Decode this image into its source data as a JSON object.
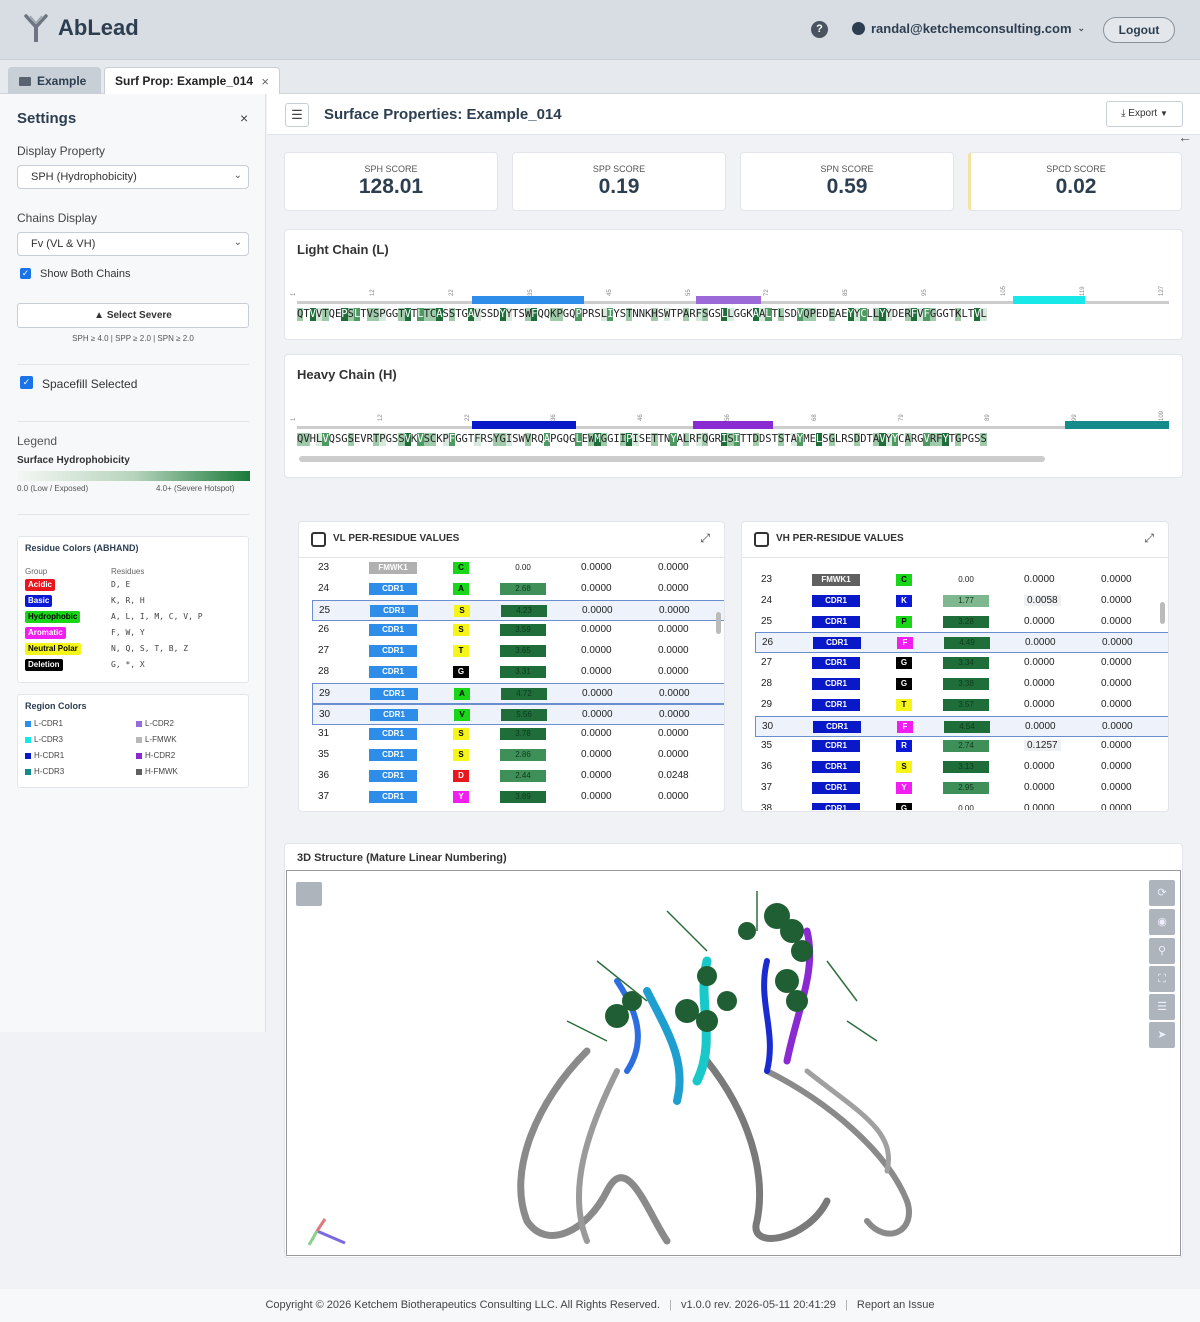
{
  "app": {
    "name": "AbLead",
    "user_email": "randal@ketchemconsulting.com",
    "logout_label": "Logout"
  },
  "tabs": [
    {
      "label": "Example"
    },
    {
      "label": "Surf Prop: Example_014"
    }
  ],
  "sidebar": {
    "title": "Settings",
    "display_property_label": "Display Property",
    "display_property_value": "SPH (Hydrophobicity)",
    "chains_display_label": "Chains Display",
    "chains_display_value": "Fv (VL & VH)",
    "show_both_chains_label": "Show Both Chains",
    "select_severe_label": "Select Severe",
    "severe_note": "SPH ≥ 4.0 | SPP ≥ 2.0 | SPN ≥ 2.0",
    "spacefill_label": "Spacefill Selected",
    "legend_label": "Legend",
    "legend_title": "Surface Hydrophobicity",
    "legend_low": "0.0 (Low / Exposed)",
    "legend_high": "4.0+ (Severe Hotspot)",
    "residue_colors": {
      "title": "Residue Colors (ABHAND)",
      "col_group": "Group",
      "col_residues": "Residues",
      "groups": [
        {
          "name": "Acidic",
          "residues": "D, E",
          "bg": "#e8171e",
          "fg": "#ffffff"
        },
        {
          "name": "Basic",
          "residues": "K, R, H",
          "bg": "#0a19d6",
          "fg": "#ffffff"
        },
        {
          "name": "Hydrophobic",
          "residues": "A, L, I, M, C, V, P",
          "bg": "#19d619",
          "fg": "#000000"
        },
        {
          "name": "Aromatic",
          "residues": "F, W, Y",
          "bg": "#f01ef0",
          "fg": "#ffffff"
        },
        {
          "name": "Neutral Polar",
          "residues": "N, Q, S, T, B, Z",
          "bg": "#f5f519",
          "fg": "#000000"
        },
        {
          "name": "Deletion",
          "residues": "G, *, X",
          "bg": "#000000",
          "fg": "#ffffff"
        }
      ]
    },
    "region_colors": {
      "title": "Region Colors",
      "items": [
        {
          "name": "L-CDR1",
          "color": "#2d8de8"
        },
        {
          "name": "L-CDR2",
          "color": "#9b6ad8"
        },
        {
          "name": "L-CDR3",
          "color": "#19e8e8"
        },
        {
          "name": "L-FMWK",
          "color": "#b8b8b8"
        },
        {
          "name": "H-CDR1",
          "color": "#0a19c8"
        },
        {
          "name": "H-CDR2",
          "color": "#8a2bd2"
        },
        {
          "name": "H-CDR3",
          "color": "#148a8a"
        },
        {
          "name": "H-FMWK",
          "color": "#606060"
        }
      ]
    }
  },
  "main": {
    "title": "Surface Properties: Example_014",
    "export_label": "Export",
    "scores": [
      {
        "label": "SPH SCORE",
        "value": "128.01"
      },
      {
        "label": "SPP SCORE",
        "value": "0.19"
      },
      {
        "label": "SPN SCORE",
        "value": "0.59"
      },
      {
        "label": "SPCD SCORE",
        "value": "0.02"
      }
    ],
    "light_chain": {
      "title": "Light Chain (L)",
      "numbers": [
        "1",
        "12",
        "22",
        "35",
        "45",
        "55",
        "72",
        "85",
        "95",
        "105",
        "119",
        "127"
      ],
      "sequence": "QTVVTQEPSLTVSPGGTVTLTCASSTGAVSSDYYTSWFQQKPGQPPRSLIYSTNNKHSWTPARFSGSLLGGKAALTLSDVQPEDEAEYYCLLYYDERFVFGGGTKLTVL",
      "regions": [
        {
          "start_pct": 20.1,
          "end_pct": 32.9,
          "color": "#2d8de8"
        },
        {
          "start_pct": 45.8,
          "end_pct": 53.2,
          "color": "#9b6ad8"
        },
        {
          "start_pct": 82.1,
          "end_pct": 90.4,
          "color": "#19e8e8"
        }
      ]
    },
    "heavy_chain": {
      "title": "Heavy Chain (H)",
      "numbers": [
        "1",
        "12",
        "22",
        "36",
        "46",
        "56",
        "68",
        "79",
        "89",
        "99",
        "109"
      ],
      "sequence": "QVHLVQSGSEVRTPGSSVKVSCKPFGGTFRSYGISWVRQAPGQGLEWMGGIIPISETTNYALRFQGRISITTDDSTSTAYMELSGLRSDDTAVYYCARGVRFYTGPGSS",
      "regions": [
        {
          "start_pct": 20.1,
          "end_pct": 32.0,
          "color": "#0a19c8"
        },
        {
          "start_pct": 45.4,
          "end_pct": 54.6,
          "color": "#8a2bd2"
        },
        {
          "start_pct": 88.1,
          "end_pct": 100.0,
          "color": "#148a8a"
        }
      ]
    },
    "vl_table": {
      "title": "VL PER-RESIDUE VALUES",
      "rows": [
        {
          "num": "23",
          "region": "FMWK1",
          "aa": "C",
          "val": "0.00",
          "c2": "0.0000",
          "c3": "0.0000",
          "sel": false
        },
        {
          "num": "24",
          "region": "CDR1",
          "aa": "A",
          "val": "2.68",
          "c2": "0.0000",
          "c3": "0.0000",
          "sel": false
        },
        {
          "num": "25",
          "region": "CDR1",
          "aa": "S",
          "val": "4.23",
          "c2": "0.0000",
          "c3": "0.0000",
          "sel": true
        },
        {
          "num": "26",
          "region": "CDR1",
          "aa": "S",
          "val": "3.59",
          "c2": "0.0000",
          "c3": "0.0000",
          "sel": false
        },
        {
          "num": "27",
          "region": "CDR1",
          "aa": "T",
          "val": "3.65",
          "c2": "0.0000",
          "c3": "0.0000",
          "sel": false
        },
        {
          "num": "28",
          "region": "CDR1",
          "aa": "G",
          "val": "3.31",
          "c2": "0.0000",
          "c3": "0.0000",
          "sel": false
        },
        {
          "num": "29",
          "region": "CDR1",
          "aa": "A",
          "val": "4.72",
          "c2": "0.0000",
          "c3": "0.0000",
          "sel": true
        },
        {
          "num": "30",
          "region": "CDR1",
          "aa": "V",
          "val": "5.56",
          "c2": "0.0000",
          "c3": "0.0000",
          "sel": true
        },
        {
          "num": "31",
          "region": "CDR1",
          "aa": "S",
          "val": "3.78",
          "c2": "0.0000",
          "c3": "0.0000",
          "sel": false
        },
        {
          "num": "35",
          "region": "CDR1",
          "aa": "S",
          "val": "2.86",
          "c2": "0.0000",
          "c3": "0.0000",
          "sel": false
        },
        {
          "num": "36",
          "region": "CDR1",
          "aa": "D",
          "val": "2.44",
          "c2": "0.0000",
          "c3": "0.0248",
          "sel": false
        },
        {
          "num": "37",
          "region": "CDR1",
          "aa": "Y",
          "val": "3.89",
          "c2": "0.0000",
          "c3": "0.0000",
          "sel": false
        }
      ]
    },
    "vh_table": {
      "title": "VH PER-RESIDUE VALUES",
      "rows": [
        {
          "num": "23",
          "region": "FMWK1",
          "aa": "C",
          "val": "0.00",
          "c2": "0.0000",
          "c3": "0.0000",
          "sel": false
        },
        {
          "num": "24",
          "region": "CDR1",
          "aa": "K",
          "val": "1.77",
          "c2": "0.0058",
          "c3": "0.0000",
          "sel": false
        },
        {
          "num": "25",
          "region": "CDR1",
          "aa": "P",
          "val": "3.28",
          "c2": "0.0000",
          "c3": "0.0000",
          "sel": false
        },
        {
          "num": "26",
          "region": "CDR1",
          "aa": "F",
          "val": "4.49",
          "c2": "0.0000",
          "c3": "0.0000",
          "sel": true
        },
        {
          "num": "27",
          "region": "CDR1",
          "aa": "G",
          "val": "3.34",
          "c2": "0.0000",
          "c3": "0.0000",
          "sel": false
        },
        {
          "num": "28",
          "region": "CDR1",
          "aa": "G",
          "val": "3.38",
          "c2": "0.0000",
          "c3": "0.0000",
          "sel": false
        },
        {
          "num": "29",
          "region": "CDR1",
          "aa": "T",
          "val": "3.57",
          "c2": "0.0000",
          "c3": "0.0000",
          "sel": false
        },
        {
          "num": "30",
          "region": "CDR1",
          "aa": "F",
          "val": "4.54",
          "c2": "0.0000",
          "c3": "0.0000",
          "sel": true
        },
        {
          "num": "35",
          "region": "CDR1",
          "aa": "R",
          "val": "2.74",
          "c2": "0.1257",
          "c3": "0.0000",
          "sel": false
        },
        {
          "num": "36",
          "region": "CDR1",
          "aa": "S",
          "val": "3.13",
          "c2": "0.0000",
          "c3": "0.0000",
          "sel": false
        },
        {
          "num": "37",
          "region": "CDR1",
          "aa": "Y",
          "val": "2.95",
          "c2": "0.0000",
          "c3": "0.0000",
          "sel": false
        },
        {
          "num": "38",
          "region": "CDR1",
          "aa": "G",
          "val": "0.00",
          "c2": "0.0000",
          "c3": "0.0000",
          "sel": false
        }
      ]
    },
    "structure_title": "3D Structure (Mature Linear Numbering)"
  },
  "footer": {
    "copyright": "Copyright © 2026 Ketchem Biotherapeutics Consulting LLC. All Rights Reserved.",
    "version": "v1.0.0 rev. 2026-05-11 20:41:29",
    "report": "Report an Issue"
  }
}
